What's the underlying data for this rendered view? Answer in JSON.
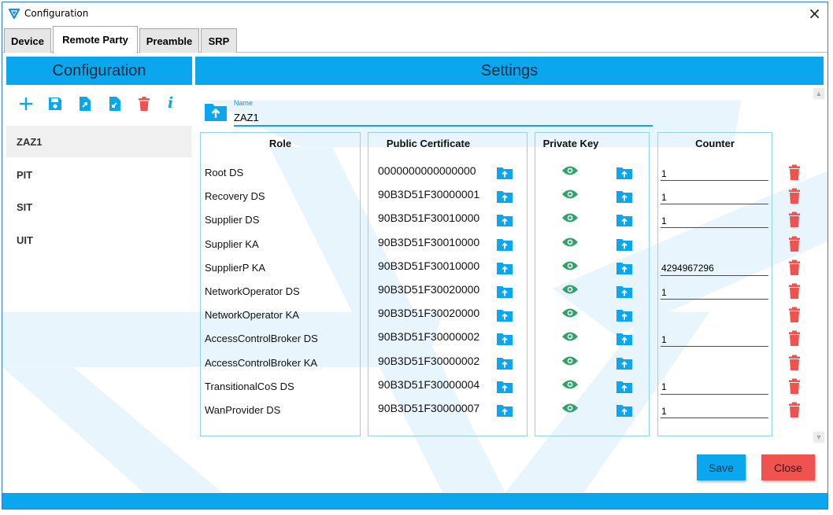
{
  "window": {
    "title": "Configuration",
    "close_glyph": "×"
  },
  "tabs": [
    {
      "label": "Device"
    },
    {
      "label": "Remote Party"
    },
    {
      "label": "Preamble"
    },
    {
      "label": "SRP"
    }
  ],
  "left_panel": {
    "header": "Configuration",
    "toolbar": {
      "add": "add-icon",
      "save": "save-icon",
      "export": "export-icon",
      "import": "import-icon",
      "delete": "delete-icon",
      "info": "info-icon",
      "info_glyph": "i"
    },
    "items": [
      {
        "label": "ZAZ1",
        "selected": true
      },
      {
        "label": "PIT"
      },
      {
        "label": "SIT"
      },
      {
        "label": "UIT"
      }
    ]
  },
  "settings": {
    "header": "Settings",
    "name_label": "Name",
    "name_value": "ZAZ1",
    "columns": {
      "role": "Role",
      "public_certificate": "Public Certificate",
      "private_key": "Private Key",
      "counter": "Counter"
    },
    "rows": [
      {
        "role": "Root DS",
        "certificate": "0000000000000000",
        "counter": "1"
      },
      {
        "role": "Recovery DS",
        "certificate": "90B3D51F30000001",
        "counter": "1"
      },
      {
        "role": "Supplier DS",
        "certificate": "90B3D51F30010000",
        "counter": "1"
      },
      {
        "role": "Supplier KA",
        "certificate": "90B3D51F30010000",
        "counter": null
      },
      {
        "role": "SupplierP KA",
        "certificate": "90B3D51F30010000",
        "counter": "4294967296"
      },
      {
        "role": "NetworkOperator DS",
        "certificate": "90B3D51F30020000",
        "counter": "1"
      },
      {
        "role": "NetworkOperator KA",
        "certificate": "90B3D51F30020000",
        "counter": null
      },
      {
        "role": "AccessControlBroker DS",
        "certificate": "90B3D51F30000002",
        "counter": "1"
      },
      {
        "role": "AccessControlBroker KA",
        "certificate": "90B3D51F30000002",
        "counter": null
      },
      {
        "role": "TransitionalCoS DS",
        "certificate": "90B3D51F30000004",
        "counter": "1"
      },
      {
        "role": "WanProvider DS",
        "certificate": "90B3D51F30000007",
        "counter": "1"
      }
    ]
  },
  "buttons": {
    "save": "Save",
    "close": "Close"
  },
  "colors": {
    "accent": "#0aa6ee",
    "danger": "#ef5350",
    "eye": "#2ea36a"
  }
}
